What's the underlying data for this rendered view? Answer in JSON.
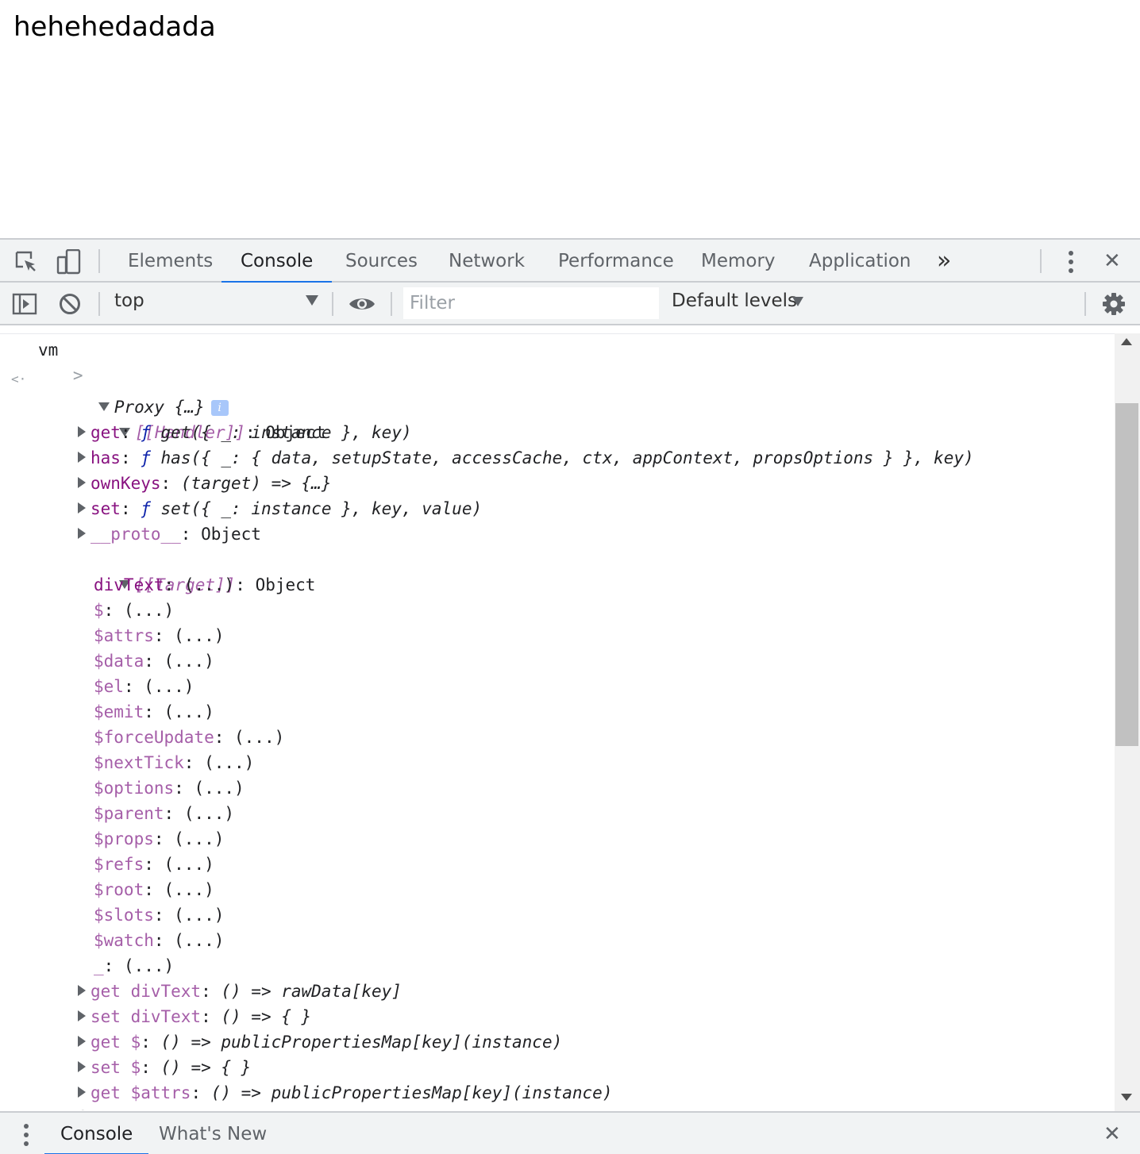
{
  "page": {
    "text": "hehehedadada"
  },
  "devtools": {
    "tabs": [
      "Elements",
      "Console",
      "Sources",
      "Network",
      "Performance",
      "Memory",
      "Application"
    ],
    "active_tab": "Console",
    "more_tabs_glyph": "»",
    "close_glyph": "✕"
  },
  "console_toolbar": {
    "context": "top",
    "filter_placeholder": "Filter",
    "levels": "Default levels"
  },
  "console": {
    "input": {
      "prompt": ">",
      "text": "vm"
    },
    "result": {
      "arrow": "<·",
      "label": "Proxy {…}",
      "info": "i"
    },
    "handler": {
      "label": "[[Handler]]",
      "value": "Object",
      "entries": [
        {
          "key": "get",
          "sep": ": ",
          "fn": "ƒ",
          "value": " get({ _: instance }, key)"
        },
        {
          "key": "has",
          "sep": ": ",
          "fn": "ƒ",
          "value": " has({ _: { data, setupState, accessCache, ctx, appContext, propsOptions } }, key)"
        },
        {
          "key": "ownKeys",
          "sep": ": ",
          "fn": "",
          "value": "(target) => {…}"
        },
        {
          "key": "set",
          "sep": ": ",
          "fn": "ƒ",
          "value": " set({ _: instance }, key, value)"
        },
        {
          "key": "__proto__",
          "sep": ": ",
          "fn": "",
          "value": "Object"
        }
      ]
    },
    "target": {
      "label": "[[Target]]",
      "value": "Object",
      "props": [
        {
          "key": "divText",
          "own": true
        },
        {
          "key": "$",
          "own": false
        },
        {
          "key": "$attrs",
          "own": false
        },
        {
          "key": "$data",
          "own": false
        },
        {
          "key": "$el",
          "own": false
        },
        {
          "key": "$emit",
          "own": false
        },
        {
          "key": "$forceUpdate",
          "own": false
        },
        {
          "key": "$nextTick",
          "own": false
        },
        {
          "key": "$options",
          "own": false
        },
        {
          "key": "$parent",
          "own": false
        },
        {
          "key": "$props",
          "own": false
        },
        {
          "key": "$refs",
          "own": false
        },
        {
          "key": "$root",
          "own": false
        },
        {
          "key": "$slots",
          "own": false
        },
        {
          "key": "$watch",
          "own": false
        },
        {
          "key": "_",
          "own": false
        }
      ],
      "lazy_value": "(...)",
      "accessors": [
        {
          "key": "get divText",
          "value": "() => rawData[key]"
        },
        {
          "key": "set divText",
          "value": "() => { }"
        },
        {
          "key": "get $",
          "value": "() => publicPropertiesMap[key](instance)"
        },
        {
          "key": "set $",
          "value": "() => { }"
        },
        {
          "key": "get $attrs",
          "value": "() => publicPropertiesMap[key](instance)"
        }
      ]
    }
  },
  "drawer": {
    "tabs": [
      "Console",
      "What's New"
    ],
    "active_tab": "Console",
    "close_glyph": "✕"
  }
}
